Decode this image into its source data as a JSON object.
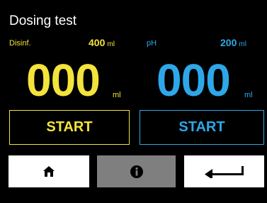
{
  "header": {
    "title": "Dosing test"
  },
  "disinf": {
    "label": "Disinf.",
    "target_value": "400",
    "target_unit": "ml",
    "current_value": "000",
    "current_unit": "ml",
    "start_label": "START",
    "color": "#f4e33b"
  },
  "ph": {
    "label": "pH",
    "target_value": "200",
    "target_unit": "ml",
    "current_value": "000",
    "current_unit": "ml",
    "start_label": "START",
    "color": "#2ea7e8"
  },
  "nav": {
    "home_icon": "home-icon",
    "info_icon": "info-icon",
    "back_icon": "return-arrow-icon"
  }
}
